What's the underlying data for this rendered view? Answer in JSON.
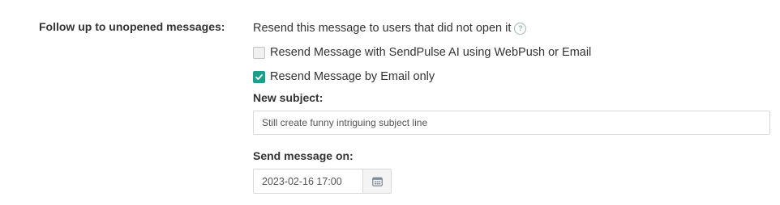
{
  "followup": {
    "label": "Follow up to unopened messages:",
    "description": "Resend this message to users that did not open it",
    "help_icon": "question-circle-icon",
    "options": [
      {
        "label": "Resend Message with SendPulse AI using WebPush or Email",
        "checked": false
      },
      {
        "label": "Resend Message by Email only",
        "checked": true
      }
    ],
    "subject": {
      "label": "New subject:",
      "value": "Still create funny intriguing subject line"
    },
    "send_on": {
      "label": "Send message on:",
      "value": "2023-02-16 17:00",
      "icon": "calendar-icon"
    }
  },
  "colors": {
    "accent": "#1aa08a",
    "text": "#333333",
    "border": "#d9d9d9",
    "help_icon": "#9fb8b2"
  }
}
